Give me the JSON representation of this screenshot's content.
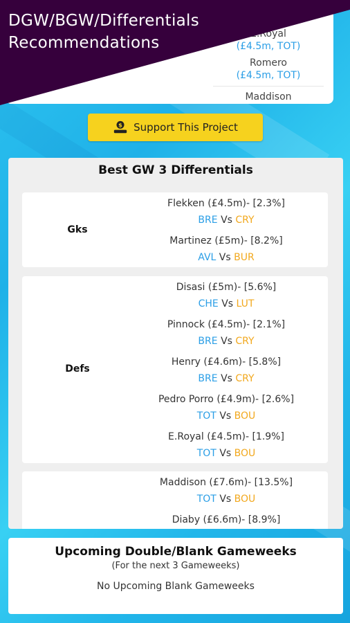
{
  "header": {
    "title_line1": "DGW/BGW/Differentials",
    "title_line2": "Recommendations"
  },
  "background_list": {
    "items": [
      {
        "name": "E.Royal",
        "team": "(£4.5m, TOT)"
      },
      {
        "name": "Romero",
        "team": "(£4.5m, TOT)"
      },
      {
        "name": "Maddison",
        "team": ""
      }
    ]
  },
  "support": {
    "label": "Support This Project",
    "icon": "money-hand-icon"
  },
  "differentials": {
    "title": "Best GW 3 Differentials",
    "groups": [
      {
        "label": "Gks",
        "players": [
          {
            "name": "Flekken (£4.5m)- [2.3%]",
            "home": "BRE",
            "vs": "Vs",
            "away": "CRY"
          },
          {
            "name": "Martinez (£5m)- [8.2%]",
            "home": "AVL",
            "vs": "Vs",
            "away": "BUR"
          }
        ]
      },
      {
        "label": "Defs",
        "players": [
          {
            "name": "Disasi (£5m)- [5.6%]",
            "home": "CHE",
            "vs": "Vs",
            "away": "LUT"
          },
          {
            "name": "Pinnock (£4.5m)- [2.1%]",
            "home": "BRE",
            "vs": "Vs",
            "away": "CRY"
          },
          {
            "name": "Henry (£4.6m)- [5.8%]",
            "home": "BRE",
            "vs": "Vs",
            "away": "CRY"
          },
          {
            "name": "Pedro Porro (£4.9m)- [2.6%]",
            "home": "TOT",
            "vs": "Vs",
            "away": "BOU"
          },
          {
            "name": "E.Royal (£4.5m)- [1.9%]",
            "home": "TOT",
            "vs": "Vs",
            "away": "BOU"
          }
        ]
      },
      {
        "label": "",
        "players": [
          {
            "name": "Maddison (£7.6m)- [13.5%]",
            "home": "TOT",
            "vs": "Vs",
            "away": "BOU"
          },
          {
            "name": "Diaby (£6.6m)- [8.9%]",
            "home": "",
            "vs": "",
            "away": ""
          }
        ]
      }
    ]
  },
  "upcoming": {
    "title": "Upcoming Double/Blank Gameweeks",
    "subtitle": "(For the next 3 Gameweeks)",
    "message": "No Upcoming Blank Gameweeks"
  },
  "colors": {
    "header_bg": "#36003c",
    "button": "#f6d21e",
    "home_team": "#2a9ee6",
    "away_team": "#f2a81d"
  }
}
